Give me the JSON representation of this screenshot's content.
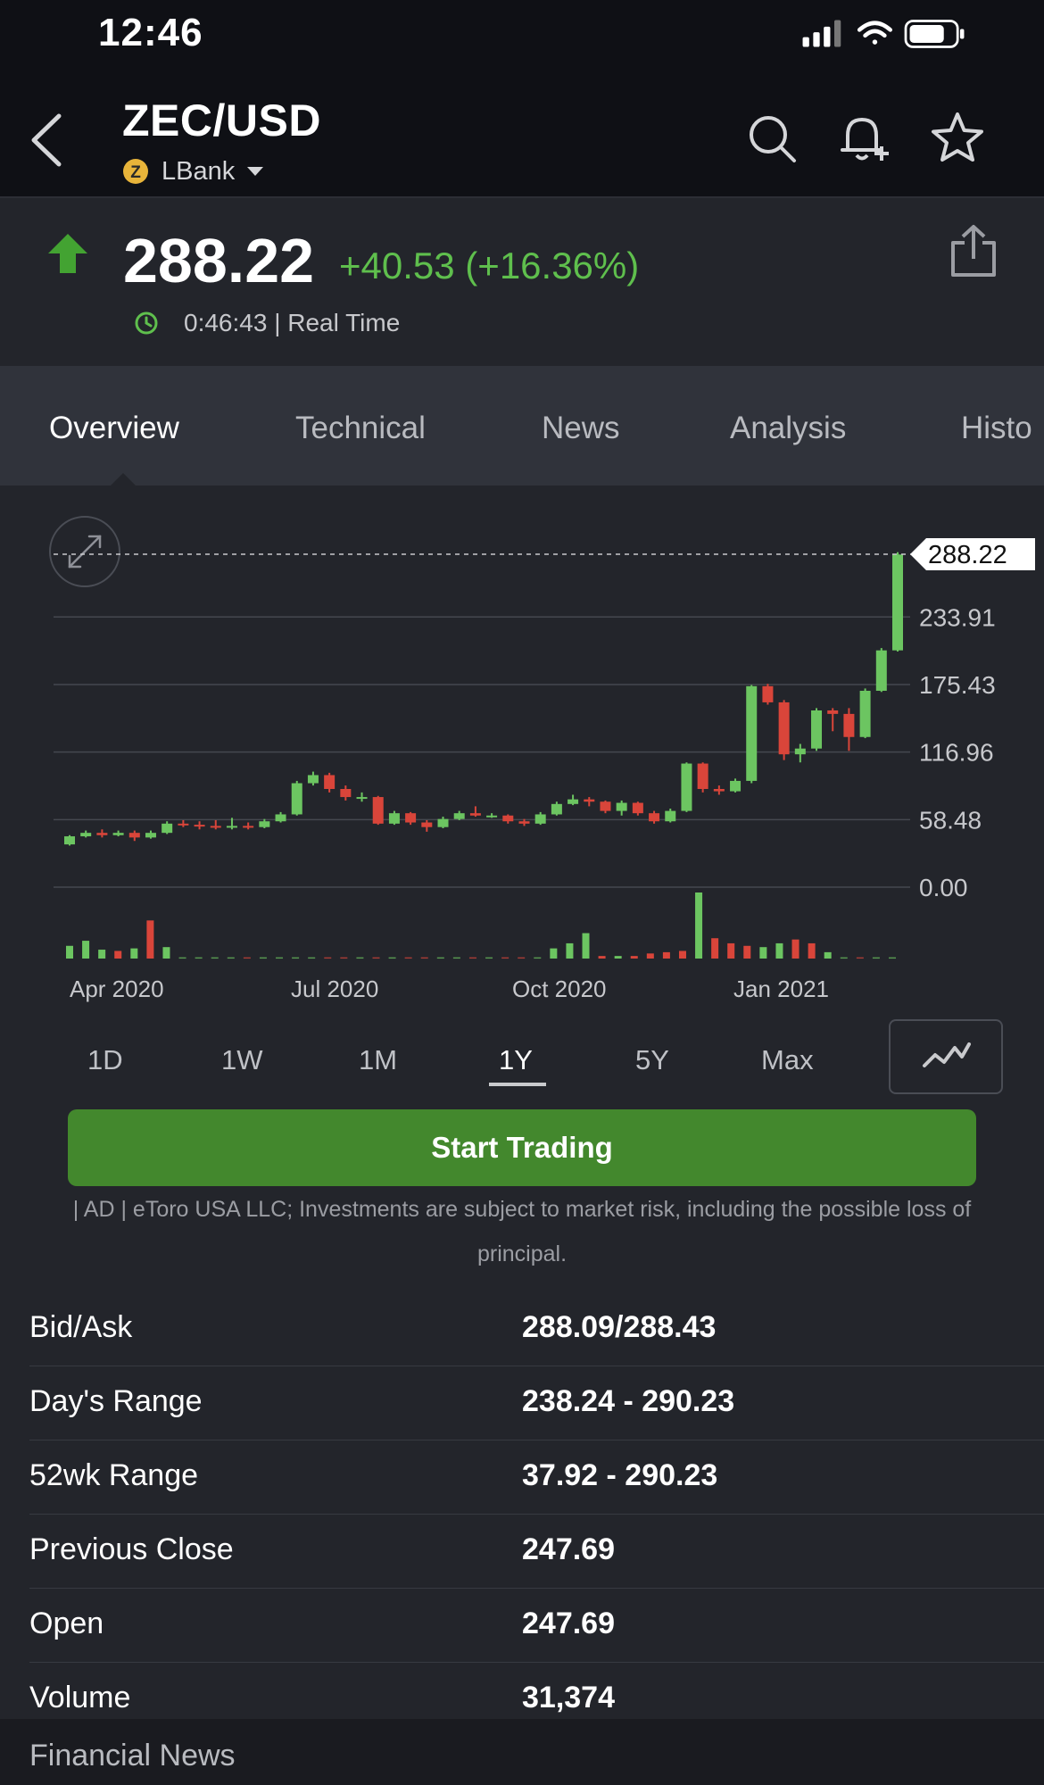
{
  "status_bar": {
    "time": "12:46"
  },
  "header": {
    "title": "ZEC/USD",
    "exchange": "LBank",
    "exchange_icon_letter": "Z"
  },
  "quote": {
    "price": "288.22",
    "change": "+40.53 (+16.36%)",
    "time": "0:46:43 | Real Time",
    "up_color": "#5fbf4d"
  },
  "tabs": [
    {
      "label": "Overview",
      "active": true
    },
    {
      "label": "Technical",
      "active": false
    },
    {
      "label": "News",
      "active": false
    },
    {
      "label": "Analysis",
      "active": false
    },
    {
      "label": "Histo",
      "active": false
    }
  ],
  "chart_data": {
    "type": "candlestick",
    "current_price_label": "288.22",
    "y_ticks": [
      "233.91",
      "175.43",
      "116.96",
      "58.48",
      "0.00"
    ],
    "x_ticks": [
      "Apr 2020",
      "Jul 2020",
      "Oct 2020",
      "Jan 2021"
    ],
    "ylim": [
      0,
      288.22
    ],
    "colors": {
      "up": "#6cc561",
      "down": "#d9453a"
    },
    "candles": [
      {
        "o": 37,
        "c": 44,
        "h": 45,
        "l": 36
      },
      {
        "o": 44,
        "c": 47,
        "h": 49,
        "l": 43
      },
      {
        "o": 47,
        "c": 45,
        "h": 50,
        "l": 43
      },
      {
        "o": 45,
        "c": 47,
        "h": 49,
        "l": 44
      },
      {
        "o": 47,
        "c": 43,
        "h": 49,
        "l": 40
      },
      {
        "o": 43,
        "c": 47,
        "h": 49,
        "l": 42
      },
      {
        "o": 47,
        "c": 55,
        "h": 57,
        "l": 46
      },
      {
        "o": 55,
        "c": 54,
        "h": 58,
        "l": 52
      },
      {
        "o": 54,
        "c": 53,
        "h": 57,
        "l": 50
      },
      {
        "o": 53,
        "c": 52,
        "h": 58,
        "l": 50
      },
      {
        "o": 52,
        "c": 53,
        "h": 60,
        "l": 50
      },
      {
        "o": 53,
        "c": 52,
        "h": 56,
        "l": 50
      },
      {
        "o": 52,
        "c": 57,
        "h": 59,
        "l": 51
      },
      {
        "o": 57,
        "c": 63,
        "h": 65,
        "l": 56
      },
      {
        "o": 63,
        "c": 90,
        "h": 92,
        "l": 62
      },
      {
        "o": 90,
        "c": 97,
        "h": 100,
        "l": 88
      },
      {
        "o": 97,
        "c": 85,
        "h": 99,
        "l": 82
      },
      {
        "o": 85,
        "c": 78,
        "h": 88,
        "l": 75
      },
      {
        "o": 78,
        "c": 78,
        "h": 82,
        "l": 74
      },
      {
        "o": 78,
        "c": 55,
        "h": 79,
        "l": 54
      },
      {
        "o": 55,
        "c": 64,
        "h": 66,
        "l": 54
      },
      {
        "o": 64,
        "c": 56,
        "h": 65,
        "l": 54
      },
      {
        "o": 56,
        "c": 52,
        "h": 58,
        "l": 48
      },
      {
        "o": 52,
        "c": 59,
        "h": 61,
        "l": 51
      },
      {
        "o": 59,
        "c": 64,
        "h": 66,
        "l": 58
      },
      {
        "o": 64,
        "c": 62,
        "h": 70,
        "l": 61
      },
      {
        "o": 62,
        "c": 62,
        "h": 64,
        "l": 60
      },
      {
        "o": 62,
        "c": 57,
        "h": 63,
        "l": 55
      },
      {
        "o": 57,
        "c": 55,
        "h": 59,
        "l": 53
      },
      {
        "o": 55,
        "c": 63,
        "h": 65,
        "l": 54
      },
      {
        "o": 63,
        "c": 72,
        "h": 74,
        "l": 62
      },
      {
        "o": 72,
        "c": 76,
        "h": 80,
        "l": 71
      },
      {
        "o": 76,
        "c": 74,
        "h": 78,
        "l": 70
      },
      {
        "o": 74,
        "c": 66,
        "h": 75,
        "l": 64
      },
      {
        "o": 66,
        "c": 73,
        "h": 75,
        "l": 62
      },
      {
        "o": 73,
        "c": 64,
        "h": 74,
        "l": 62
      },
      {
        "o": 64,
        "c": 57,
        "h": 66,
        "l": 55
      },
      {
        "o": 57,
        "c": 66,
        "h": 68,
        "l": 56
      },
      {
        "o": 66,
        "c": 107,
        "h": 108,
        "l": 65
      },
      {
        "o": 107,
        "c": 85,
        "h": 108,
        "l": 82
      },
      {
        "o": 85,
        "c": 83,
        "h": 88,
        "l": 80
      },
      {
        "o": 83,
        "c": 92,
        "h": 94,
        "l": 82
      },
      {
        "o": 92,
        "c": 174,
        "h": 175,
        "l": 90
      },
      {
        "o": 174,
        "c": 160,
        "h": 176,
        "l": 158
      },
      {
        "o": 160,
        "c": 115,
        "h": 162,
        "l": 110
      },
      {
        "o": 115,
        "c": 120,
        "h": 124,
        "l": 108
      },
      {
        "o": 120,
        "c": 153,
        "h": 155,
        "l": 118
      },
      {
        "o": 153,
        "c": 150,
        "h": 155,
        "l": 135
      },
      {
        "o": 150,
        "c": 130,
        "h": 155,
        "l": 118
      },
      {
        "o": 130,
        "c": 170,
        "h": 172,
        "l": 129
      },
      {
        "o": 170,
        "c": 205,
        "h": 207,
        "l": 169
      },
      {
        "o": 205,
        "c": 288,
        "h": 290,
        "l": 204
      }
    ],
    "volume": [
      {
        "v": 10,
        "up": true
      },
      {
        "v": 14,
        "up": true
      },
      {
        "v": 7,
        "up": true
      },
      {
        "v": 6,
        "up": false
      },
      {
        "v": 8,
        "up": true
      },
      {
        "v": 30,
        "up": false
      },
      {
        "v": 9,
        "up": true
      },
      {
        "v": 1,
        "up": true
      },
      {
        "v": 1,
        "up": true
      },
      {
        "v": 1,
        "up": true
      },
      {
        "v": 1,
        "up": true
      },
      {
        "v": 1,
        "up": false
      },
      {
        "v": 1,
        "up": true
      },
      {
        "v": 1,
        "up": true
      },
      {
        "v": 1,
        "up": true
      },
      {
        "v": 1,
        "up": true
      },
      {
        "v": 1,
        "up": false
      },
      {
        "v": 1,
        "up": false
      },
      {
        "v": 1,
        "up": true
      },
      {
        "v": 1,
        "up": false
      },
      {
        "v": 1,
        "up": true
      },
      {
        "v": 1,
        "up": false
      },
      {
        "v": 1,
        "up": false
      },
      {
        "v": 1,
        "up": true
      },
      {
        "v": 1,
        "up": true
      },
      {
        "v": 1,
        "up": false
      },
      {
        "v": 1,
        "up": true
      },
      {
        "v": 1,
        "up": false
      },
      {
        "v": 1,
        "up": false
      },
      {
        "v": 1,
        "up": true
      },
      {
        "v": 8,
        "up": true
      },
      {
        "v": 12,
        "up": true
      },
      {
        "v": 20,
        "up": true
      },
      {
        "v": 2,
        "up": false
      },
      {
        "v": 2,
        "up": true
      },
      {
        "v": 2,
        "up": false
      },
      {
        "v": 4,
        "up": false
      },
      {
        "v": 5,
        "up": false
      },
      {
        "v": 6,
        "up": false
      },
      {
        "v": 52,
        "up": true
      },
      {
        "v": 16,
        "up": false
      },
      {
        "v": 12,
        "up": false
      },
      {
        "v": 10,
        "up": false
      },
      {
        "v": 9,
        "up": true
      },
      {
        "v": 12,
        "up": true
      },
      {
        "v": 15,
        "up": false
      },
      {
        "v": 12,
        "up": false
      },
      {
        "v": 5,
        "up": true
      },
      {
        "v": 1,
        "up": true
      },
      {
        "v": 1,
        "up": false
      },
      {
        "v": 1,
        "up": true
      },
      {
        "v": 1,
        "up": true
      }
    ]
  },
  "ranges": [
    {
      "label": "1D",
      "active": false
    },
    {
      "label": "1W",
      "active": false
    },
    {
      "label": "1M",
      "active": false
    },
    {
      "label": "1Y",
      "active": true
    },
    {
      "label": "5Y",
      "active": false
    },
    {
      "label": "Max",
      "active": false
    }
  ],
  "cta": {
    "label": "Start Trading",
    "disclaimer": "| AD | eToro USA LLC; Investments are subject to market risk, including the possible loss of principal."
  },
  "stats": [
    {
      "label": "Bid/Ask",
      "value": "288.09/288.43"
    },
    {
      "label": "Day's Range",
      "value": "238.24 - 290.23"
    },
    {
      "label": "52wk Range",
      "value": "37.92 - 290.23"
    },
    {
      "label": "Previous Close",
      "value": "247.69"
    },
    {
      "label": "Open",
      "value": "247.69"
    },
    {
      "label": "Volume",
      "value": "31,374"
    }
  ],
  "section": {
    "financial_news": "Financial News"
  }
}
